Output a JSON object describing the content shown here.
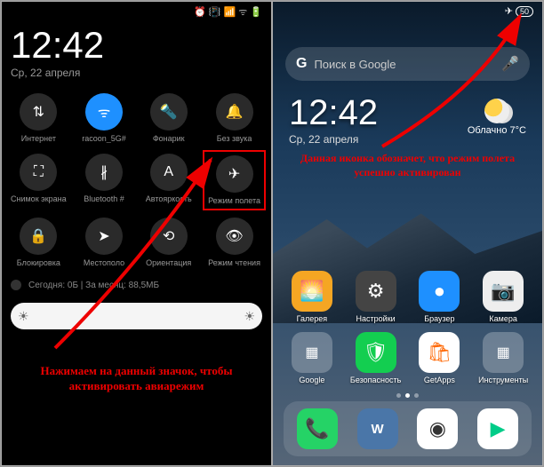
{
  "left": {
    "time": "12:42",
    "date": "Ср, 22 апреля",
    "status_icons": [
      "alarm",
      "vibrate",
      "wifi",
      "signal",
      "battery"
    ],
    "tiles": [
      {
        "name": "internet",
        "label": "Интернет",
        "icon": "arrows-ud",
        "on": false
      },
      {
        "name": "wifi",
        "label": "racoon_5G#",
        "icon": "wifi",
        "on": true
      },
      {
        "name": "flashlight",
        "label": "Фонарик",
        "icon": "flashlight",
        "on": false
      },
      {
        "name": "mute",
        "label": "Без звука",
        "icon": "bell",
        "on": false
      },
      {
        "name": "screenshot",
        "label": "Снимок экрана",
        "icon": "screenshot",
        "on": false
      },
      {
        "name": "bluetooth",
        "label": "Bluetooth #",
        "icon": "bluetooth",
        "on": false
      },
      {
        "name": "autobright",
        "label": "Автояркость",
        "icon": "auto-a",
        "on": false
      },
      {
        "name": "airplane",
        "label": "Режим полета",
        "icon": "airplane",
        "on": false,
        "highlight": true
      },
      {
        "name": "lock",
        "label": "Блокировка",
        "icon": "lock",
        "on": false
      },
      {
        "name": "location",
        "label": "Местополо",
        "icon": "nav",
        "on": false
      },
      {
        "name": "orientation",
        "label": "Ориентация",
        "icon": "rotate",
        "on": false
      },
      {
        "name": "reading",
        "label": "Режим чтения",
        "icon": "eye",
        "on": false
      }
    ],
    "data_usage": "Сегодня: 0Б  |  За месяц: 88,5МБ",
    "annotation": "Нажимаем на данный значок, чтобы активировать авиарежим"
  },
  "right": {
    "status_icons": [
      "airplane",
      "battery"
    ],
    "battery_text": "50",
    "search_placeholder": "Поиск в Google",
    "time": "12:42",
    "date": "Ср, 22 апреля",
    "weather": {
      "text": "Облачно",
      "temp": "7°C"
    },
    "annotation": "Данная иконка обозначет, что режим полета успешно активирован",
    "apps_row1": [
      {
        "name": "gallery",
        "label": "Галерея",
        "bg": "#f5a623",
        "glyph": "🌅"
      },
      {
        "name": "settings",
        "label": "Настройки",
        "bg": "#444",
        "glyph": "⚙"
      },
      {
        "name": "browser",
        "label": "Браузер",
        "bg": "#1e90ff",
        "glyph": "●"
      },
      {
        "name": "camera",
        "label": "Камера",
        "bg": "#eee",
        "glyph": "📷"
      }
    ],
    "apps_row2": [
      {
        "name": "google",
        "label": "Google",
        "bg": "#fff",
        "glyph": "▦"
      },
      {
        "name": "security",
        "label": "Безопасность",
        "bg": "#13c e50",
        "glyph": "🛡"
      },
      {
        "name": "getapps",
        "label": "GetApps",
        "bg": "#fff",
        "glyph": "🛍"
      },
      {
        "name": "tools",
        "label": "Инструменты",
        "bg": "#fff",
        "glyph": "▦"
      }
    ],
    "dock": [
      {
        "name": "phone",
        "bg": "#25d366",
        "glyph": "📞"
      },
      {
        "name": "vk",
        "bg": "#4a76a8",
        "glyph": "VK"
      },
      {
        "name": "chrome",
        "bg": "#fff",
        "glyph": "◉"
      },
      {
        "name": "play",
        "bg": "#fff",
        "glyph": "▶"
      }
    ]
  }
}
